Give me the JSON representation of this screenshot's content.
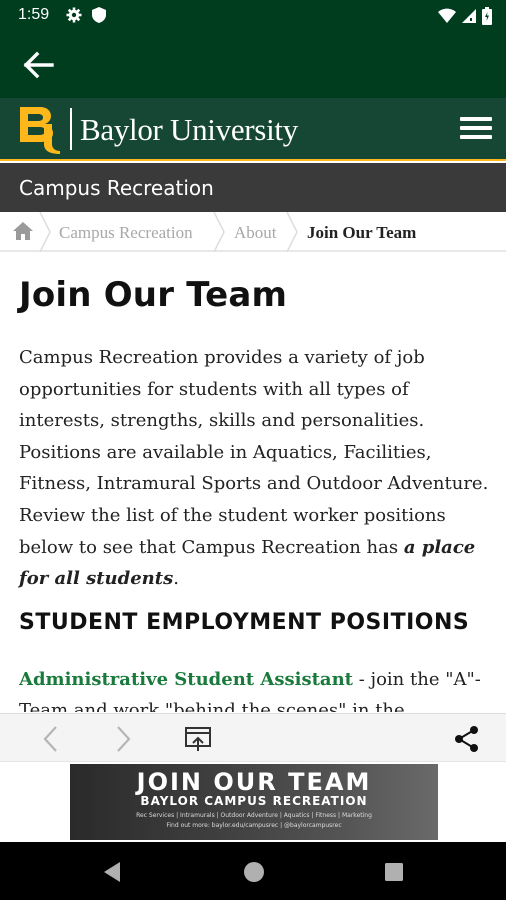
{
  "status_bar": {
    "time": "1:59",
    "left_icons": [
      "gear-icon",
      "shield-icon"
    ],
    "right_icons": [
      "wifi-icon",
      "signal-icon",
      "battery-icon"
    ]
  },
  "app_bar": {
    "back_icon": "arrow-left-icon"
  },
  "header": {
    "logo_icon": "bu-logo",
    "site_name": "Baylor University",
    "menu_icon": "hamburger-menu-icon",
    "brand_green": "#154734",
    "brand_gold": "#ffb81c"
  },
  "section_bar": {
    "title": "Campus Recreation"
  },
  "breadcrumb": {
    "home_icon": "home-icon",
    "items": [
      {
        "label": "Campus Recreation",
        "current": false
      },
      {
        "label": "About",
        "current": false
      },
      {
        "label": "Join Our Team",
        "current": true
      }
    ]
  },
  "content": {
    "title": "Join Our Team",
    "intro_text": "Campus Recreation provides a variety of job opportunities for students with all types of interests, strengths, skills and personalities. Positions are available in Aquatics, Facilities, Fitness, Intramural Sports and Outdoor Adventure. Review the list of the student worker positions below to see that Campus Recreation has ",
    "intro_emphasis": "a place for all students",
    "intro_end": ".",
    "section_heading": "STUDENT EMPLOYMENT POSITIONS",
    "position_link": "Administrative Student Assistant",
    "position_desc_1": " - join the \"A\"-",
    "position_desc_2": "Team and work \"behind the scenes\" in the",
    "link_color": "#1a7a3c"
  },
  "browser_toolbar": {
    "icons": [
      "chevron-left-icon",
      "chevron-right-icon",
      "open-in-browser-icon",
      "share-icon"
    ]
  },
  "ad": {
    "title": "JOIN OUR TEAM",
    "subtitle": "BAYLOR CAMPUS RECREATION",
    "fine_line_1": "Rec Services | Intramurals | Outdoor Adventure | Aquatics | Fitness | Marketing",
    "fine_line_2": "Find out more: baylor.edu/campusrec | @baylorcampusrec"
  },
  "nav_bar": {
    "icons": [
      "back-triangle-icon",
      "home-circle-icon",
      "recents-square-icon"
    ]
  }
}
